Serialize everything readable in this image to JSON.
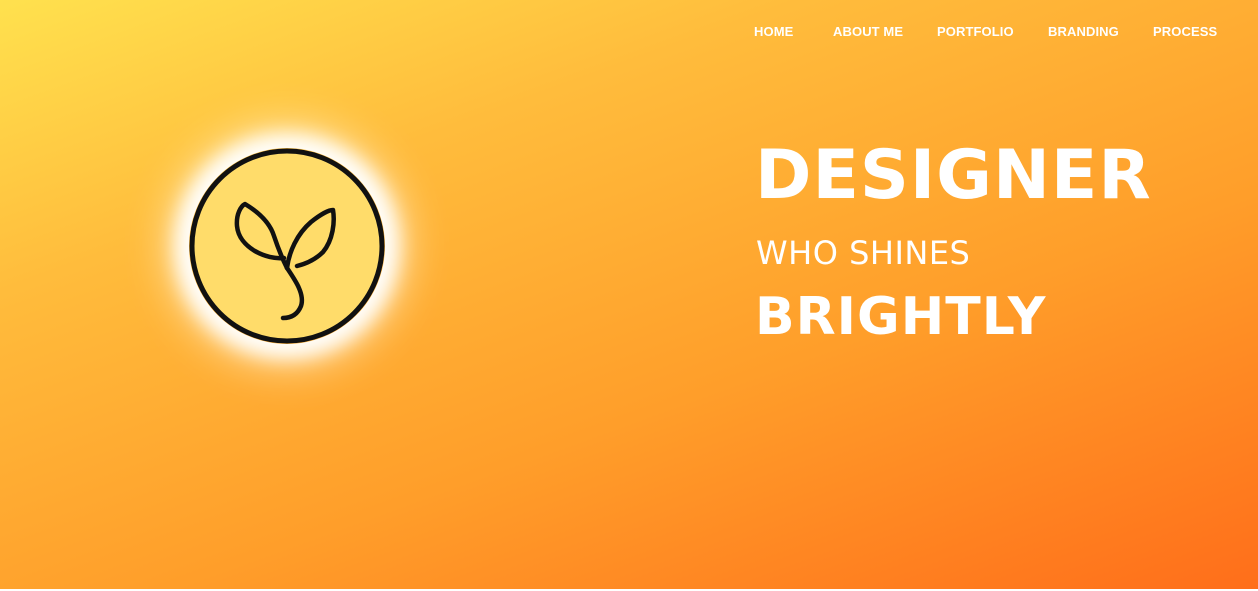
{
  "nav": {
    "items": [
      {
        "label": "HOME"
      },
      {
        "label": "ABOUT ME"
      },
      {
        "label": "PORTFOLIO"
      },
      {
        "label": "BRANDING"
      },
      {
        "label": "PROCESS"
      }
    ]
  },
  "logo": {
    "icon": "sprout-icon",
    "fill_color": "#ffdc6a",
    "stroke_color": "#111111"
  },
  "hero": {
    "line1": "DESIGNER",
    "line2": "WHO SHINES",
    "line3": "BRIGHTLY"
  },
  "colors": {
    "gradient_start": "#ffe14e",
    "gradient_end": "#ff6e1a",
    "text": "#ffffff"
  }
}
